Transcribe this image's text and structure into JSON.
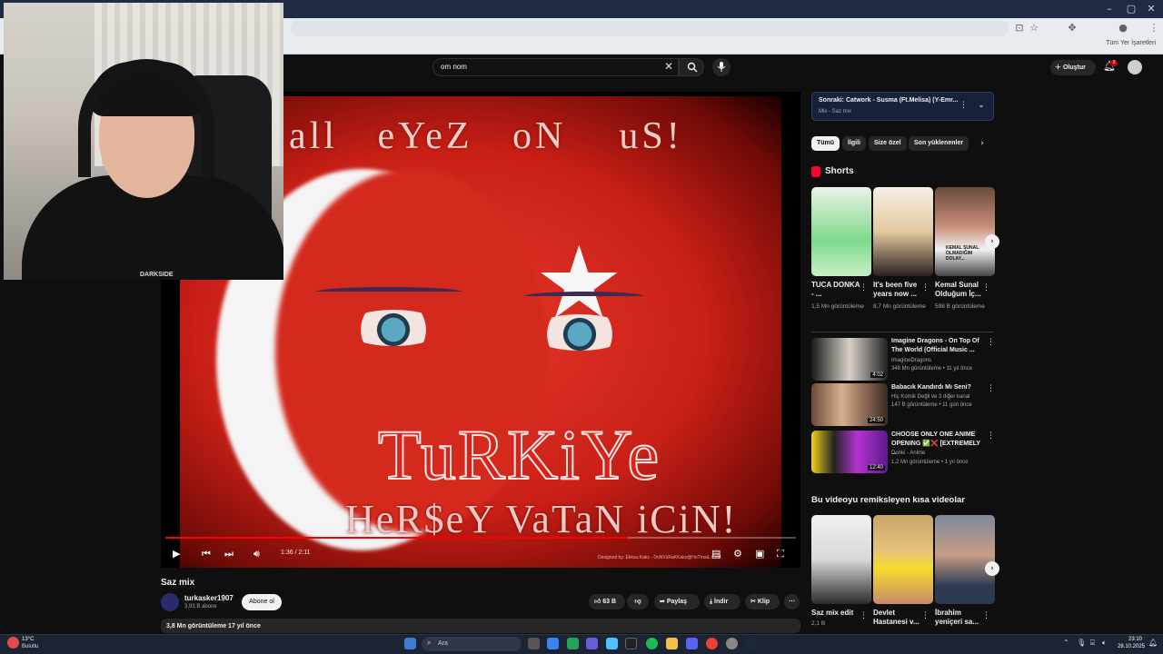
{
  "browser": {
    "bookmarks_all": "Tüm Yer İşaretleri",
    "window_controls": [
      "–",
      "▢",
      "✕"
    ]
  },
  "header": {
    "search_value": "om nom",
    "create_label": "Oluştur",
    "notifications_count": "3"
  },
  "player": {
    "overlay_top": "all   eYeZ   oN    uS!",
    "overlay_main": "TuRKiYe",
    "overlay_bottom": "HeR$eY VaTaN iCiN!",
    "overlay_credit": "Designed by: Ekkau Kakz - DoNVuRaKKakz@HoTmaiL.CoM",
    "time": "1:36 / 2:11",
    "progress": 0.733
  },
  "video": {
    "title": "Saz mix",
    "channel": "turkasker1907",
    "subscribers": "3,93 B abone",
    "subscribe_label": "Abone ol",
    "likes": "63 B",
    "share_label": "Paylaş",
    "download_label": "İndir",
    "clip_label": "Klip",
    "description_meta": "3,8 Mn görüntüleme  17 yıl önce"
  },
  "sidebar": {
    "mix_next": "Sonraki: Catwork - Susma (Ft.Melisa) (Y-Emr...",
    "mix_sub": "Mix - Saz mix",
    "chips": [
      "Tümü",
      "İlgili",
      "Size özel",
      "Son yüklenenler"
    ],
    "shorts_heading": "Shorts",
    "shorts": [
      {
        "title": "TUCA DONKA - ...",
        "views": "1,5 Mn görüntüleme"
      },
      {
        "title": "It's been five years now ...",
        "views": "8,7 Mn görüntüleme"
      },
      {
        "title": "Kemal Sunal Olduğum İç...",
        "views": "598 B görüntüleme",
        "thumb_text": "KEMAL SUNAL OLMADIĞIM DOLAY..."
      }
    ],
    "recommended": [
      {
        "title": "Imagine Dragons - On Top Of The World (Official Music ...",
        "channel": "ImagineDragons",
        "meta": "348 Mn görüntüleme • 11 yıl önce",
        "duration": "4:02"
      },
      {
        "title": "Babacık Kandırdı Mı Seni?",
        "channel": "Hiç Komik Değil  ve 3 diğer kanal",
        "meta": "147 B görüntüleme • 11 gün önce",
        "duration": "24:50"
      },
      {
        "title": "CHOOSE ONLY ONE ANIME OPENING ✅❌ [EXTREMELY ...",
        "channel": "Donki - Anime",
        "meta": "1,2 Mn görüntüleme • 1 yıl önce",
        "duration": "12:40"
      }
    ],
    "remix_heading": "Bu videoyu remiksleyen kısa videolar",
    "remixes": [
      {
        "title": "Saz mix edit",
        "views": "2,1 B"
      },
      {
        "title": "Devlet Hastanesi v...",
        "views": ""
      },
      {
        "title": "İbrahim yeniçeri sa...",
        "views": ""
      }
    ]
  },
  "taskbar": {
    "weather_temp": "13°C",
    "weather_desc": "Bulutlu",
    "search_placeholder": "Ara",
    "time": "23:10",
    "date": "28.10.2025"
  },
  "webcam": {
    "shirt_text": "DARKSIDE"
  }
}
